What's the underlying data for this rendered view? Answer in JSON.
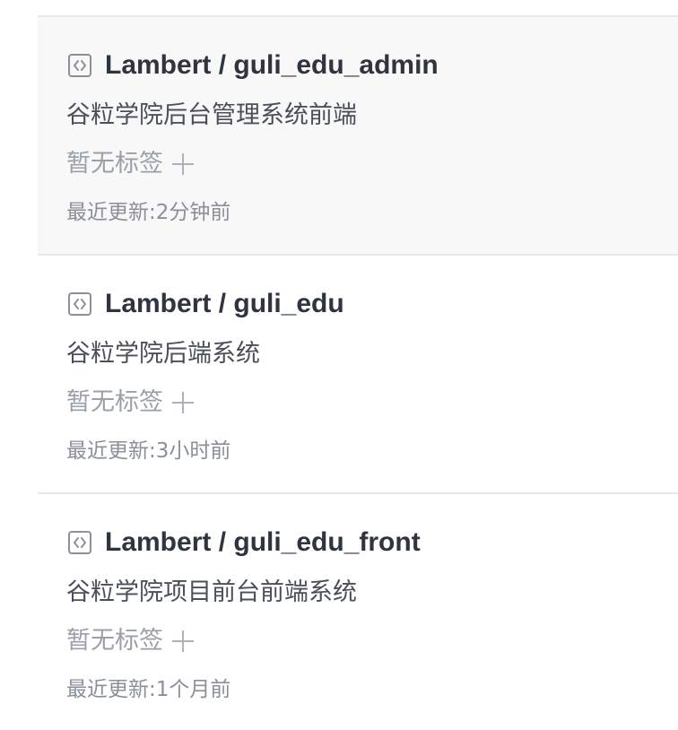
{
  "repos": [
    {
      "name": "Lambert / guli_edu_admin",
      "description": "谷粒学院后台管理系统前端",
      "tag_text": "暂无标签",
      "updated_label": "最近更新:",
      "updated_value": "2分钟前"
    },
    {
      "name": "Lambert / guli_edu",
      "description": "谷粒学院后端系统",
      "tag_text": "暂无标签",
      "updated_label": "最近更新:",
      "updated_value": "3小时前"
    },
    {
      "name": "Lambert / guli_edu_front",
      "description": "谷粒学院项目前台前端系统",
      "tag_text": "暂无标签",
      "updated_label": "最近更新:",
      "updated_value": "1个月前"
    }
  ],
  "colors": {
    "hover_background": "#f8f8f9",
    "divider": "#e6e8eb",
    "title": "#2e3440",
    "muted": "#9aa0a9"
  },
  "icons": {
    "repo": "code-repo-icon",
    "add_tag": "plus-icon"
  }
}
